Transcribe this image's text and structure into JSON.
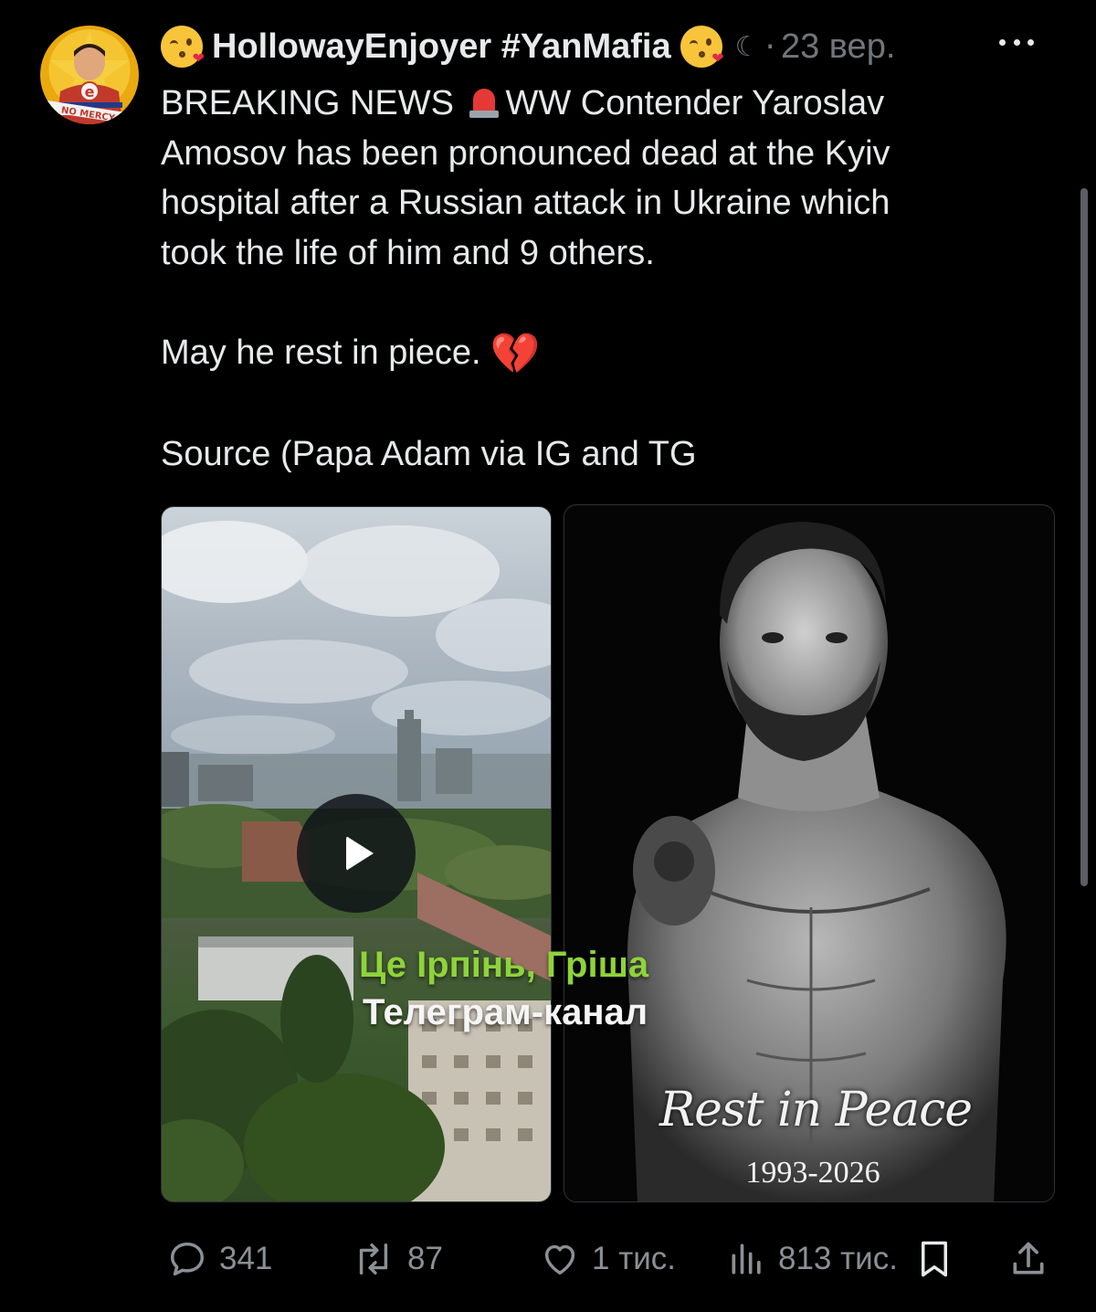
{
  "post": {
    "author": {
      "display_name": "HollowayEnjoyer #YanMafia",
      "emoji_left": "kissing-heart-emoji",
      "emoji_right": "kissing-heart-emoji",
      "moon_icon": "moon-icon",
      "separator": "·",
      "time": "23 вер.",
      "avatar_badge_letter": "e",
      "avatar_banner_text": "NO MERCY"
    },
    "text": {
      "line1_a": "BREAKING NEWS",
      "line1_icon": "police-light-icon",
      "line1_b": "WW Contender  Yaroslav",
      "line2": "Amosov has been pronounced dead at the Kyiv",
      "line3": "hospital after a Russian attack in Ukraine which",
      "line4": "took the life of him and 9 others.",
      "line5": "May he rest in piece.",
      "line5_icon": "broken-heart-icon",
      "line6": "Source (Papa Adam via IG and TG"
    },
    "media": {
      "video_watermark_line1": "Це Ірпінь, Гріша",
      "video_watermark_line2": "Телеграм-канал",
      "memorial_title": "Rest in Peace",
      "memorial_years": "1993-2026"
    },
    "actions": {
      "replies": "341",
      "reposts": "87",
      "likes": "1 тис.",
      "views": "813 тис."
    }
  },
  "colors": {
    "background": "#000000",
    "text": "#e7e9ea",
    "muted": "#71767b",
    "watermark_green": "#8ed33a"
  }
}
